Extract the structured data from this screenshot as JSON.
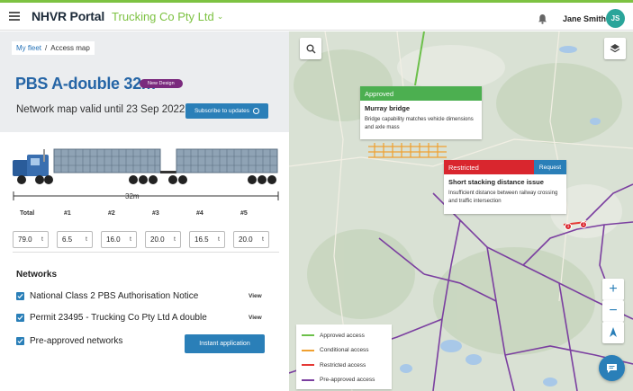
{
  "header": {
    "app_name": "NHVR Portal",
    "company": "Trucking Co Pty Ltd",
    "user_name": "Jane Smith",
    "user_initials": "JS",
    "accent": "#7dc242"
  },
  "breadcrumb": {
    "root": "My fleet",
    "separator": "/",
    "current": "Access map"
  },
  "vehicle": {
    "title": "PBS A-double 32m",
    "badge": "New Design",
    "validity": "Network map valid until 23 Sep 2022",
    "subscribe_label": "Subscribe to updates",
    "length_label": "32m"
  },
  "axles": {
    "headers": [
      "Total",
      "#1",
      "#2",
      "#3",
      "#4",
      "#5"
    ],
    "values": [
      "79.0",
      "6.5",
      "16.0",
      "20.0",
      "16.5",
      "20.0"
    ],
    "unit": "t"
  },
  "networks": {
    "title": "Networks",
    "items": [
      {
        "label": "National Class 2 PBS Authorisation Notice",
        "action": "View",
        "checked": true
      },
      {
        "label": "Permit 23495 - Trucking Co Pty Ltd A double",
        "action": "View",
        "checked": true
      },
      {
        "label": "Pre-approved networks",
        "action": "",
        "checked": true
      }
    ],
    "instant_label": "Instant application"
  },
  "map": {
    "approved_popup": {
      "status": "Approved",
      "title": "Murray bridge",
      "body": "Bridge capability matches vehicle dimensions and axle mass",
      "color": "#4caf50"
    },
    "restricted_popup": {
      "status": "Restricted",
      "action": "Request",
      "title": "Short stacking distance issue",
      "body": "Insufficient distance between railway crossing and traffic intersection",
      "color": "#d9262e"
    },
    "legend": [
      {
        "label": "Approved access",
        "color": "#6cc04a"
      },
      {
        "label": "Conditional access",
        "color": "#f0a030"
      },
      {
        "label": "Restricted access",
        "color": "#e53935"
      },
      {
        "label": "Pre-approved access",
        "color": "#7b3fa0"
      }
    ],
    "pins": [
      "1",
      "1"
    ]
  }
}
